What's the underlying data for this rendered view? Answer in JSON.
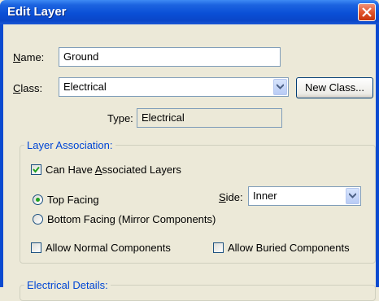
{
  "window": {
    "title": "Edit Layer"
  },
  "name": {
    "label_underlined": "N",
    "label_rest": "ame:",
    "value": "Ground"
  },
  "class_field": {
    "label_underlined": "C",
    "label_rest": "lass:",
    "value": "Electrical",
    "new_class_label": "New Class..."
  },
  "type_field": {
    "label": "Type:",
    "value": "Electrical"
  },
  "layer_association": {
    "title": "Layer Association:",
    "can_have_associated": {
      "before": "Can Have ",
      "underlined": "A",
      "after": "ssociated Layers",
      "checked": true
    },
    "top_facing": {
      "label": "Top Facing",
      "selected": true
    },
    "bottom_facing": {
      "label": "Bottom Facing (Mirror Components)",
      "selected": false
    },
    "side": {
      "label_underlined": "S",
      "label_rest": "ide:",
      "value": "Inner"
    },
    "allow_normal": {
      "label": "Allow Normal Components",
      "checked": false
    },
    "allow_buried": {
      "label": "Allow Buried Components",
      "checked": false
    }
  },
  "electrical_details": {
    "title": "Electrical Details:"
  },
  "colors": {
    "title_bar": "#0a4fd6",
    "group_title": "#0046d5",
    "dialog_bg": "#ece9d8"
  }
}
